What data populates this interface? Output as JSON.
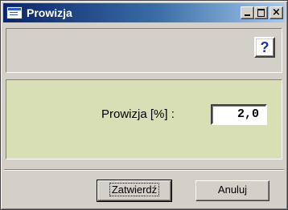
{
  "window": {
    "title": "Prowizja",
    "close_glyph": "×",
    "icons": [
      "app-icon",
      "minimize-icon",
      "maximize-icon",
      "close-icon",
      "help-icon"
    ]
  },
  "toolbar": {
    "help_label": "?"
  },
  "form": {
    "label": "Prowizja [%] :",
    "value": "2,0"
  },
  "buttons": {
    "confirm_label": "Zatwierdź",
    "cancel_label": "Anuluj"
  },
  "colors": {
    "titlebar_start": "#0a246a",
    "titlebar_end": "#a6caf0",
    "panel_bg": "#d8dfb4",
    "help_text": "#1a2fc2"
  }
}
